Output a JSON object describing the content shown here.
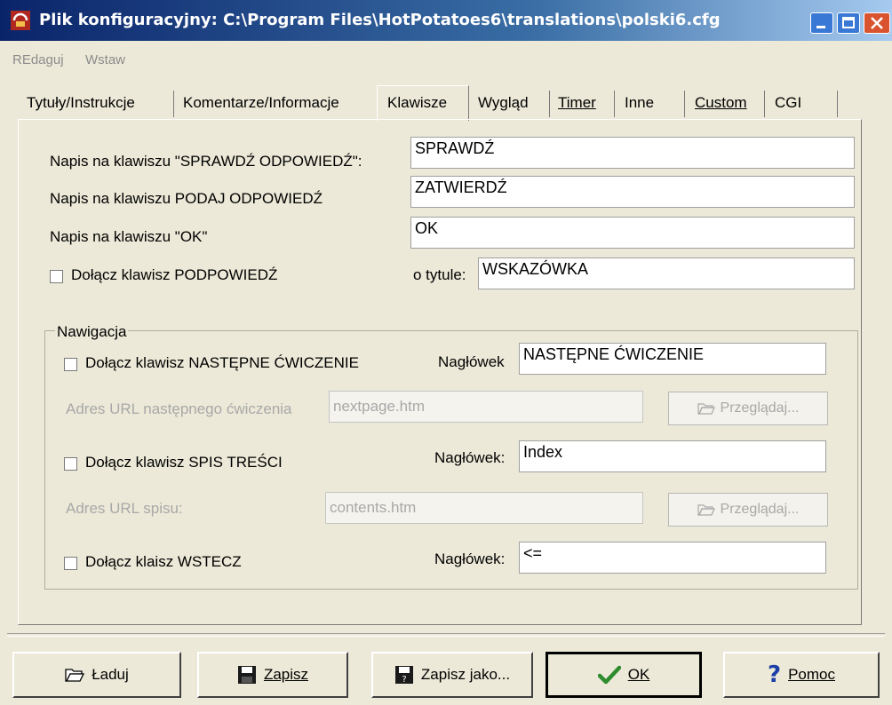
{
  "window": {
    "title": "Plik konfiguracyjny: C:\\Program Files\\HotPotatoes6\\translations\\polski6.cfg"
  },
  "menu": [
    "REdaguj",
    "Wstaw"
  ],
  "tabs": [
    {
      "label": "Tytuły/Instrukcje",
      "active": false
    },
    {
      "label": "Komentarze/Informacje",
      "active": false
    },
    {
      "label": "Klawisze",
      "active": true
    },
    {
      "label": "Wygląd",
      "active": false
    },
    {
      "label": "Timer",
      "active": false
    },
    {
      "label": "Inne",
      "active": false
    },
    {
      "label": "Custom",
      "active": false
    },
    {
      "label": "CGI",
      "active": false
    }
  ],
  "buttons_section": {
    "check_label": "Napis na klawiszu \"SPRAWDŹ ODPOWIEDŹ\":",
    "check_value": "SPRAWDŹ",
    "give_label": "Napis na klawiszu PODAJ ODPOWIEDŹ",
    "give_value": "ZATWIERDŹ",
    "ok_label": "Napis na klawiszu \"OK\"",
    "ok_value": "OK",
    "hint_checkbox_label": "Dołącz klawisz PODPOWIEDŹ",
    "hint_title_label": "o tytule:",
    "hint_title_value": "WSKAZÓWKA"
  },
  "navigation": {
    "legend": "Nawigacja",
    "next": {
      "checkbox_label": "Dołącz klawisz NASTĘPNE ĆWICZENIE",
      "header_label": "Nagłówek",
      "header_value": "NASTĘPNE ĆWICZENIE",
      "url_label": "Adres URL następnego ćwiczenia",
      "url_value": "nextpage.htm",
      "browse_label": "Przeglądaj..."
    },
    "contents": {
      "checkbox_label": "Dołącz klawisz SPIS TREŚCI",
      "header_label": "Nagłówek:",
      "header_value": "Index",
      "url_label": "Adres URL spisu:",
      "url_value": "contents.htm",
      "browse_label": "Przeglądaj..."
    },
    "back": {
      "checkbox_label": "Dołącz klaisz WSTECZ",
      "header_label": "Nagłówek:",
      "header_value": "<="
    }
  },
  "footer": {
    "load": "Ładuj",
    "save": "Zapisz",
    "save_as": "Zapisz jako...",
    "ok": "OK",
    "help": "Pomoc"
  },
  "colors": {
    "titlebar_start": "#0a246a",
    "face": "#ece9d8",
    "ok_check": "#2e8b2e",
    "help_q": "#1c3fa8"
  }
}
